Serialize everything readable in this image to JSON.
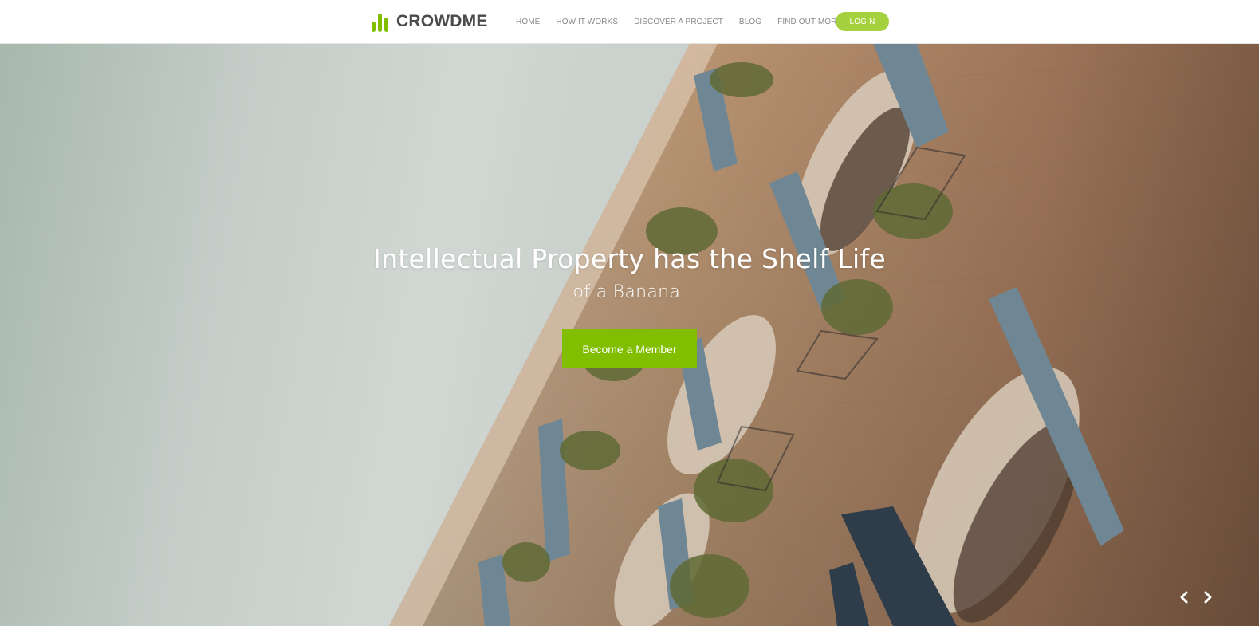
{
  "brand": {
    "name": "CROWDME",
    "logo_icon": "bar-chart-icon",
    "accent_color": "#82be00",
    "login_color": "#a6d13e"
  },
  "nav": {
    "items": [
      {
        "label": "HOME"
      },
      {
        "label": "HOW IT WORKS"
      },
      {
        "label": "DISCOVER A PROJECT"
      },
      {
        "label": "BLOG"
      },
      {
        "label": "FIND OUT MORE"
      }
    ],
    "login_label": "LOGIN"
  },
  "hero": {
    "title": "Intellectual Property has the Shelf Life",
    "subtitle": "of a Banana.",
    "cta_label": "Become a Member",
    "prev_icon": "chevron-left-icon",
    "next_icon": "chevron-right-icon"
  }
}
